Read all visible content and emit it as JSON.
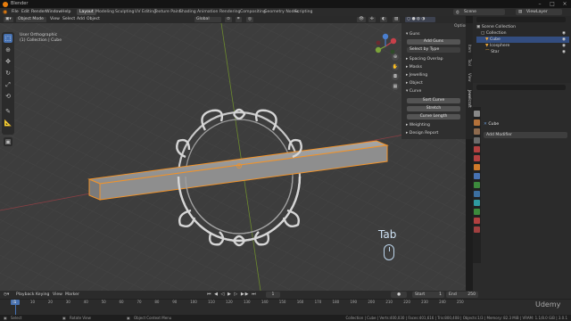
{
  "app": {
    "title": "Blender"
  },
  "menus": [
    "File",
    "Edit",
    "Render",
    "Window",
    "Help"
  ],
  "workspaces": [
    {
      "label": "Layout",
      "active": true
    },
    {
      "label": "Modeling"
    },
    {
      "label": "Sculpting"
    },
    {
      "label": "UV Editing"
    },
    {
      "label": "Texture Paint"
    },
    {
      "label": "Shading"
    },
    {
      "label": "Animation"
    },
    {
      "label": "Rendering"
    },
    {
      "label": "Compositing"
    },
    {
      "label": "Geometry Nodes"
    },
    {
      "label": "Scripting"
    }
  ],
  "scene": {
    "name": "Scene",
    "view_layer": "ViewLayer"
  },
  "viewport_header": {
    "mode": "Object Mode",
    "view": "View",
    "select": "Select",
    "add": "Add",
    "object": "Object",
    "orientation": "Global",
    "options": "Options"
  },
  "viewport_info": {
    "line1": "User Orthographic",
    "line2": "(1) Collection | Cube"
  },
  "npanel": {
    "sections": [
      {
        "label": "Guns"
      },
      {
        "label": "Add Guns",
        "type": "button"
      },
      {
        "label": "Select by Type",
        "type": "dropdown"
      },
      {
        "label": "Spacing Overlap"
      },
      {
        "label": "Masks"
      },
      {
        "label": "Jewelling"
      },
      {
        "label": "Object"
      },
      {
        "label": "Curve"
      },
      {
        "label": "Sort Curve",
        "type": "button"
      },
      {
        "label": "Stretch",
        "type": "button"
      },
      {
        "label": "Curve Length",
        "type": "button"
      },
      {
        "label": "Weighting"
      },
      {
        "label": "Design Report"
      }
    ],
    "tabs": [
      "Item",
      "Tool",
      "View",
      "Jewelcraft"
    ]
  },
  "outliner": {
    "rows": [
      {
        "label": "Scene Collection"
      },
      {
        "label": "Collection"
      },
      {
        "label": "Cube",
        "selected": true
      },
      {
        "label": "Icosphere"
      },
      {
        "label": "Star"
      }
    ]
  },
  "properties": {
    "object_name": "Cube",
    "add_modifier": "Add Modifier"
  },
  "timeline": {
    "menus": [
      "Playback",
      "Keying",
      "View",
      "Marker"
    ],
    "start_label": "Start",
    "start_value": "1",
    "end_label": "End",
    "end_value": "250",
    "current_frame": "1",
    "ticks": [
      "0",
      "10",
      "20",
      "30",
      "40",
      "50",
      "60",
      "70",
      "80",
      "90",
      "100",
      "110",
      "120",
      "130",
      "140",
      "150",
      "160",
      "170",
      "180",
      "190",
      "200",
      "210",
      "220",
      "230",
      "240",
      "250"
    ]
  },
  "status": {
    "select": "Select",
    "rotate": "Rotate View",
    "context": "Object Context Menu",
    "right": "Collection | Cube | Verts:400,030 | Faces:401,616 | Tris:800,408 | Objects:1/3 | Memory: 82.3 MiB | VRAM: 1.1/8.0 GiB | 3.0.1"
  },
  "overlay": {
    "tab_hint": "Tab",
    "watermark": "Udemy"
  },
  "colors": {
    "accent": "#4772b3",
    "selection_outline": "#f0932b",
    "blender_orange": "#e87d0d"
  }
}
